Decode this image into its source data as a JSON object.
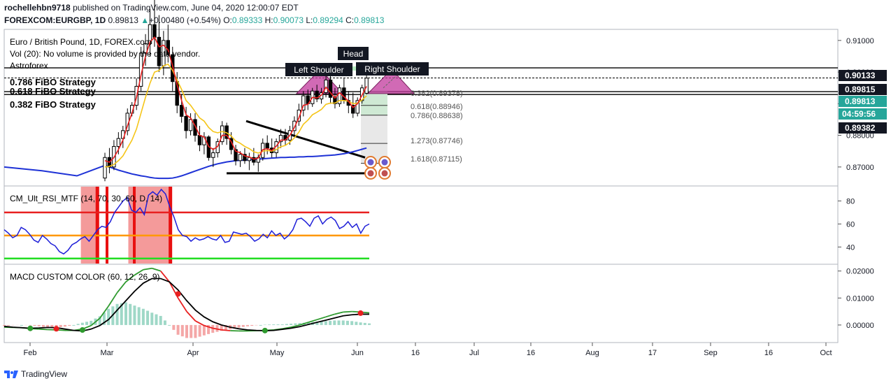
{
  "header": {
    "author": "rochellehbn9718",
    "published_text": "published on TradingView.com, June 04, 2020 12:00:07 EDT",
    "symbol": "FOREXCOM:EURGBP, 1D",
    "last": "0.89813",
    "change_arrow": "▲",
    "change": "+0.00480 (+0.54%)",
    "o_label": "O:",
    "o": "0.89333",
    "h_label": "H:",
    "h": "0.90073",
    "l_label": "L:",
    "l": "0.89294",
    "c_label": "C:",
    "c": "0.89813"
  },
  "legend": {
    "line1": "Euro / British Pound, 1D, FOREX.com",
    "line2": "Vol (20): No volume is provided by the data vendor.",
    "line3": "Astroforex",
    "fibo": [
      "0.786 FiBO Strategy",
      "0.618 FiBO Strategy",
      "0.382 FiBO Strategy"
    ]
  },
  "annotations": {
    "head": "Head",
    "left_shoulder": "Left Shoulder",
    "right_shoulder": "Right Shoulder",
    "fib_levels": [
      "0.382(0.89378)",
      "0.618(0.88946)",
      "0.786(0.88638)",
      "1.273(0.87746)",
      "1.618(0.87115)"
    ]
  },
  "price_labels": [
    {
      "text": "0.90133",
      "bg": "#131722",
      "fg": "#ffffff"
    },
    {
      "text": "0.89815",
      "bg": "#131722",
      "fg": "#ffffff"
    },
    {
      "text": "0.89813",
      "bg": "#26a69a",
      "fg": "#ffffff"
    },
    {
      "text": "04:59:56",
      "bg": "#26a69a",
      "fg": "#ffffff"
    },
    {
      "text": "0.89382",
      "bg": "#131722",
      "fg": "#ffffff"
    }
  ],
  "colors": {
    "up": "#26a69a",
    "down": "#ef5350",
    "ema_red": "#e91e1e",
    "ema_yellow": "#f5c518",
    "ma_blue": "#1e32d6",
    "pattern": "#c2389c",
    "rsi": "#1f1fd8",
    "macd": "#000000",
    "signal_green": "#2e9a2e",
    "signal_red": "#e82020"
  },
  "chart_data": [
    {
      "type": "candlestick",
      "title": "Euro / British Pound, 1D, FOREX.com",
      "x_ticks": [
        "Feb",
        "Mar",
        "Apr",
        "May",
        "Jun",
        "16",
        "Jul",
        "16",
        "Aug",
        "17",
        "Sep",
        "16",
        "Oct"
      ],
      "y_ticks": [
        "0.91000",
        "0.90000",
        "0.89000",
        "0.88000",
        "0.87000"
      ],
      "ylim": [
        0.864,
        0.9135
      ],
      "ohlc": [
        [
          0.8665,
          0.8745,
          0.8655,
          0.873
        ],
        [
          0.873,
          0.876,
          0.868,
          0.87
        ],
        [
          0.87,
          0.8785,
          0.869,
          0.8765
        ],
        [
          0.8765,
          0.881,
          0.874,
          0.879
        ],
        [
          0.879,
          0.883,
          0.876,
          0.8815
        ],
        [
          0.8815,
          0.8885,
          0.88,
          0.887
        ],
        [
          0.887,
          0.8905,
          0.886,
          0.8895
        ],
        [
          0.8895,
          0.898,
          0.888,
          0.8955
        ],
        [
          0.8955,
          0.908,
          0.894,
          0.906
        ],
        [
          0.906,
          0.912,
          0.902,
          0.909
        ],
        [
          0.909,
          0.92,
          0.905,
          0.915
        ],
        [
          0.915,
          0.923,
          0.908,
          0.911
        ],
        [
          0.911,
          0.918,
          0.9,
          0.902
        ],
        [
          0.902,
          0.913,
          0.899,
          0.91
        ],
        [
          0.91,
          0.915,
          0.903,
          0.9055
        ],
        [
          0.9055,
          0.908,
          0.894,
          0.897
        ],
        [
          0.897,
          0.9,
          0.887,
          0.8895
        ],
        [
          0.8895,
          0.893,
          0.884,
          0.886
        ],
        [
          0.886,
          0.889,
          0.879,
          0.8815
        ],
        [
          0.8815,
          0.887,
          0.88,
          0.885
        ],
        [
          0.885,
          0.887,
          0.878,
          0.88
        ],
        [
          0.88,
          0.883,
          0.875,
          0.877
        ],
        [
          0.877,
          0.881,
          0.874,
          0.8795
        ],
        [
          0.8795,
          0.88,
          0.872,
          0.873
        ],
        [
          0.873,
          0.876,
          0.87,
          0.8745
        ],
        [
          0.8745,
          0.879,
          0.873,
          0.878
        ],
        [
          0.878,
          0.8845,
          0.877,
          0.883
        ],
        [
          0.883,
          0.884,
          0.877,
          0.879
        ],
        [
          0.879,
          0.881,
          0.874,
          0.8755
        ],
        [
          0.8755,
          0.877,
          0.8705,
          0.872
        ],
        [
          0.872,
          0.875,
          0.87,
          0.874
        ],
        [
          0.874,
          0.876,
          0.871,
          0.872
        ],
        [
          0.872,
          0.8745,
          0.869,
          0.873
        ],
        [
          0.873,
          0.876,
          0.8705,
          0.8715
        ],
        [
          0.8715,
          0.874,
          0.8685,
          0.873
        ],
        [
          0.873,
          0.879,
          0.872,
          0.8775
        ],
        [
          0.8775,
          0.88,
          0.874,
          0.876
        ],
        [
          0.876,
          0.879,
          0.873,
          0.8745
        ],
        [
          0.8745,
          0.879,
          0.873,
          0.878
        ],
        [
          0.878,
          0.882,
          0.876,
          0.88
        ],
        [
          0.88,
          0.882,
          0.877,
          0.8785
        ],
        [
          0.8785,
          0.883,
          0.877,
          0.8815
        ],
        [
          0.8815,
          0.886,
          0.88,
          0.8845
        ],
        [
          0.8845,
          0.89,
          0.883,
          0.888
        ],
        [
          0.888,
          0.894,
          0.886,
          0.8925
        ],
        [
          0.8925,
          0.8945,
          0.888,
          0.89
        ],
        [
          0.89,
          0.895,
          0.889,
          0.894
        ],
        [
          0.894,
          0.896,
          0.8905,
          0.8915
        ],
        [
          0.8915,
          0.895,
          0.89,
          0.8935
        ],
        [
          0.8935,
          0.899,
          0.892,
          0.8975
        ],
        [
          0.8975,
          0.901,
          0.89,
          0.892
        ],
        [
          0.892,
          0.895,
          0.8885,
          0.89
        ],
        [
          0.89,
          0.896,
          0.889,
          0.895
        ],
        [
          0.895,
          0.898,
          0.89,
          0.891
        ],
        [
          0.891,
          0.894,
          0.887,
          0.8895
        ],
        [
          0.8895,
          0.8935,
          0.8855,
          0.887
        ],
        [
          0.887,
          0.892,
          0.886,
          0.891
        ],
        [
          0.891,
          0.896,
          0.89,
          0.895
        ],
        [
          0.8933,
          0.9007,
          0.8929,
          0.8981
        ]
      ],
      "series": [
        {
          "name": "EMA fast",
          "color": "#e91e1e",
          "values": [
            0.872,
            0.8715,
            0.873,
            0.8755,
            0.8785,
            0.883,
            0.887,
            0.892,
            0.899,
            0.905,
            0.9095,
            0.911,
            0.908,
            0.9085,
            0.907,
            0.902,
            0.896,
            0.891,
            0.8865,
            0.8855,
            0.883,
            0.88,
            0.8795,
            0.8765,
            0.8755,
            0.8765,
            0.88,
            0.88,
            0.878,
            0.875,
            0.8745,
            0.8735,
            0.8732,
            0.8725,
            0.8728,
            0.8755,
            0.8758,
            0.8752,
            0.8766,
            0.8785,
            0.8785,
            0.88,
            0.8825,
            0.8855,
            0.8895,
            0.8898,
            0.892,
            0.8918,
            0.8927,
            0.8952,
            0.8935,
            0.8918,
            0.8935,
            0.8922,
            0.8908,
            0.8888,
            0.89,
            0.8927,
            0.8955
          ]
        },
        {
          "name": "EMA slow",
          "color": "#f5c518",
          "values": [
            0.87,
            0.8702,
            0.8708,
            0.872,
            0.8735,
            0.876,
            0.8785,
            0.882,
            0.887,
            0.892,
            0.8965,
            0.9,
            0.9005,
            0.902,
            0.9025,
            0.9005,
            0.8975,
            0.8945,
            0.891,
            0.8895,
            0.8875,
            0.8855,
            0.8845,
            0.8825,
            0.8812,
            0.8808,
            0.8812,
            0.8808,
            0.8798,
            0.8782,
            0.8775,
            0.8765,
            0.8758,
            0.8748,
            0.8744,
            0.875,
            0.8752,
            0.875,
            0.8755,
            0.8764,
            0.8768,
            0.8778,
            0.8792,
            0.881,
            0.8835,
            0.8848,
            0.8865,
            0.8873,
            0.8882,
            0.8898,
            0.8902,
            0.8902,
            0.891,
            0.891,
            0.8908,
            0.89,
            0.8902,
            0.8912,
            0.8925
          ]
        }
      ],
      "ma_series": {
        "name": "MA",
        "color": "#1e32d6",
        "values": [
          0.8705,
          0.87,
          0.8695,
          0.869,
          0.8686,
          0.8682,
          0.8678,
          0.8675,
          0.8672,
          0.867,
          0.8667,
          0.8665,
          0.8664,
          0.8664,
          0.8664,
          0.8665,
          0.8668,
          0.8672,
          0.8677,
          0.8682,
          0.8687,
          0.8692,
          0.8697,
          0.8702,
          0.8706,
          0.871,
          0.8713,
          0.8716,
          0.8718,
          0.872,
          0.8721,
          0.8722,
          0.8723,
          0.8724,
          0.8725,
          0.8726,
          0.8727,
          0.8728,
          0.8729,
          0.873,
          0.873,
          0.8731,
          0.8731,
          0.8732,
          0.8732,
          0.8733,
          0.8733,
          0.8734,
          0.8735,
          0.8736,
          0.8737,
          0.8738,
          0.874,
          0.8742,
          0.8745,
          0.8748,
          0.8752,
          0.8756,
          0.876
        ]
      }
    },
    {
      "type": "line",
      "title": "CM_Ult_RSI_MTF (14, 70, 30, 60, D, 14)",
      "y_ticks": [
        "80",
        "60",
        "40"
      ],
      "ylim": [
        25,
        93
      ],
      "levels": [
        {
          "value": 70,
          "color": "#e82020"
        },
        {
          "value": 50,
          "color": "#ff9800"
        },
        {
          "value": 30,
          "color": "#22dd22"
        }
      ],
      "series": [
        {
          "name": "RSI",
          "color": "#1f1fd8",
          "values": [
            55,
            52,
            48,
            50,
            57,
            55,
            51,
            46,
            44,
            50,
            47,
            43,
            41,
            36,
            34,
            37,
            42,
            44,
            47,
            49,
            45,
            50,
            55,
            58,
            57,
            62,
            70,
            75,
            80,
            83,
            72,
            70,
            74,
            68,
            85,
            88,
            85,
            90,
            86,
            75,
            66,
            55,
            50,
            49,
            45,
            48,
            46,
            47,
            49,
            47,
            46,
            50,
            44,
            45,
            53,
            52,
            51,
            52,
            49,
            45,
            47,
            51,
            48,
            54,
            50,
            52,
            47,
            50,
            55,
            64,
            65,
            62,
            58,
            65,
            67,
            60,
            64,
            66,
            63,
            56,
            58,
            62,
            57,
            60,
            52,
            58,
            60
          ]
        }
      ],
      "overbought_zones": [
        [
          0.21,
          0.26
        ],
        [
          0.34,
          0.46
        ]
      ]
    },
    {
      "type": "line",
      "title": "MACD CUSTOM COLOR (60, 12, 26, 9)",
      "y_ticks": [
        "0.02000",
        "0.01000",
        "0.00000"
      ],
      "ylim": [
        -0.0065,
        0.0225
      ],
      "series": [
        {
          "name": "MACD",
          "color": "#000000",
          "values": [
            -0.0005,
            -0.0008,
            -0.001,
            -0.0012,
            -0.0011,
            -0.0009,
            -0.001,
            -0.0015,
            -0.002,
            -0.0022,
            -0.0015,
            -0.0002,
            0.002,
            0.0055,
            0.009,
            0.0125,
            0.0155,
            0.0172,
            0.0172,
            0.016,
            0.013,
            0.009,
            0.0055,
            0.003,
            0.0012,
            0.0,
            -0.0008,
            -0.0014,
            -0.0018,
            -0.002,
            -0.0021,
            -0.002,
            -0.0016,
            -0.0012,
            -0.0006,
            0.0002,
            0.001,
            0.0018,
            0.0026,
            0.0034,
            0.0038,
            0.004,
            0.004
          ]
        },
        {
          "name": "Signal",
          "color": "#2e9a2e",
          "values": [
            -0.0008,
            -0.0009,
            -0.001,
            -0.0013,
            -0.0015,
            -0.0017,
            -0.0018,
            -0.002,
            -0.002,
            -0.0015,
            -0.0002,
            0.0025,
            0.007,
            0.012,
            0.016,
            0.0185,
            0.0205,
            0.021,
            0.02,
            0.016,
            0.01,
            0.005,
            0.0015,
            -0.0002,
            -0.0012,
            -0.0018,
            -0.0021,
            -0.0022,
            -0.0022,
            -0.0021,
            -0.002,
            -0.0018,
            -0.0014,
            -0.0008,
            0.0,
            0.001,
            0.002,
            0.003,
            0.004,
            0.0048,
            0.005,
            0.0048,
            0.0045
          ]
        }
      ]
    }
  ]
}
